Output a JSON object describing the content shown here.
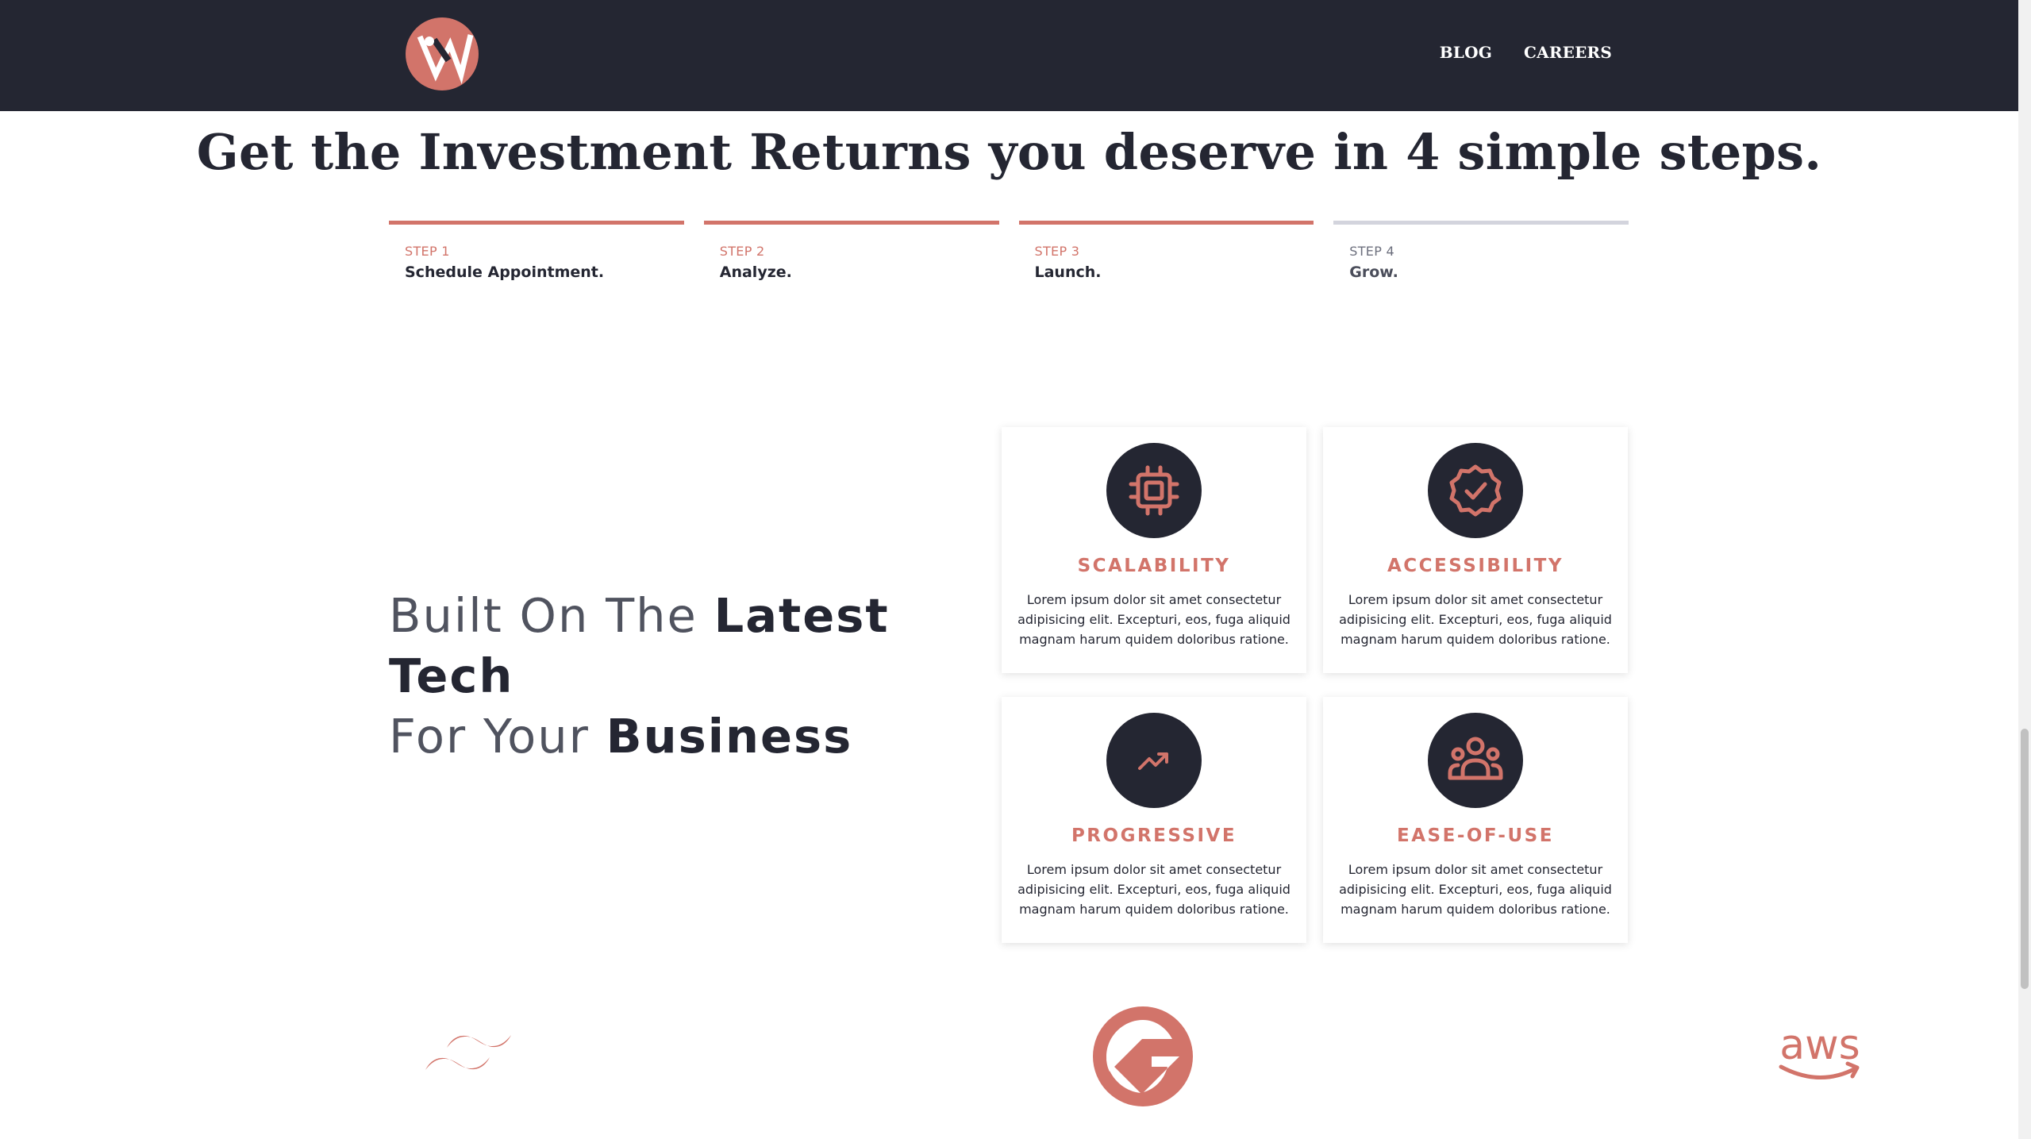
{
  "colors": {
    "accent": "#d2746a",
    "dark": "#242632",
    "inactive_rule": "#d3d4dd"
  },
  "header": {
    "logo_icon": "w-monogram-logo",
    "nav": [
      {
        "label": "BLOG"
      },
      {
        "label": "CAREERS"
      }
    ]
  },
  "hero": {
    "headline": "Get the Investment Returns you deserve in 4 simple steps."
  },
  "steps": [
    {
      "label": "STEP 1",
      "title": "Schedule Appointment.",
      "state": "completed"
    },
    {
      "label": "STEP 2",
      "title": "Analyze.",
      "state": "completed"
    },
    {
      "label": "STEP 3",
      "title": "Launch.",
      "state": "completed"
    },
    {
      "label": "STEP 4",
      "title": "Grow.",
      "state": "pending"
    }
  ],
  "features": {
    "heading": {
      "line1_light": "Built On The",
      "line1_bold": "Latest Tech",
      "line2_light": "For Your",
      "line2_bold": "Business"
    },
    "cards": [
      {
        "icon": "chip-icon",
        "title": "SCALABILITY",
        "text": "Lorem ipsum dolor sit amet consectetur adipisicing elit. Excepturi, eos, fuga aliquid magnam harum quidem doloribus ratione."
      },
      {
        "icon": "badge-check-icon",
        "title": "ACCESSIBILITY",
        "text": "Lorem ipsum dolor sit amet consectetur adipisicing elit. Excepturi, eos, fuga aliquid magnam harum quidem doloribus ratione."
      },
      {
        "icon": "trending-up-icon",
        "title": "PROGRESSIVE",
        "text": "Lorem ipsum dolor sit amet consectetur adipisicing elit. Excepturi, eos, fuga aliquid magnam harum quidem doloribus ratione."
      },
      {
        "icon": "user-group-icon",
        "title": "EASE-OF-USE",
        "text": "Lorem ipsum dolor sit amet consectetur adipisicing elit. Excepturi, eos, fuga aliquid magnam harum quidem doloribus ratione."
      }
    ]
  },
  "brands": [
    {
      "icon": "tailwind-logo-icon"
    },
    {
      "icon": "gatsby-logo-icon"
    },
    {
      "icon": "aws-logo-icon",
      "wordmark": "aws"
    }
  ]
}
